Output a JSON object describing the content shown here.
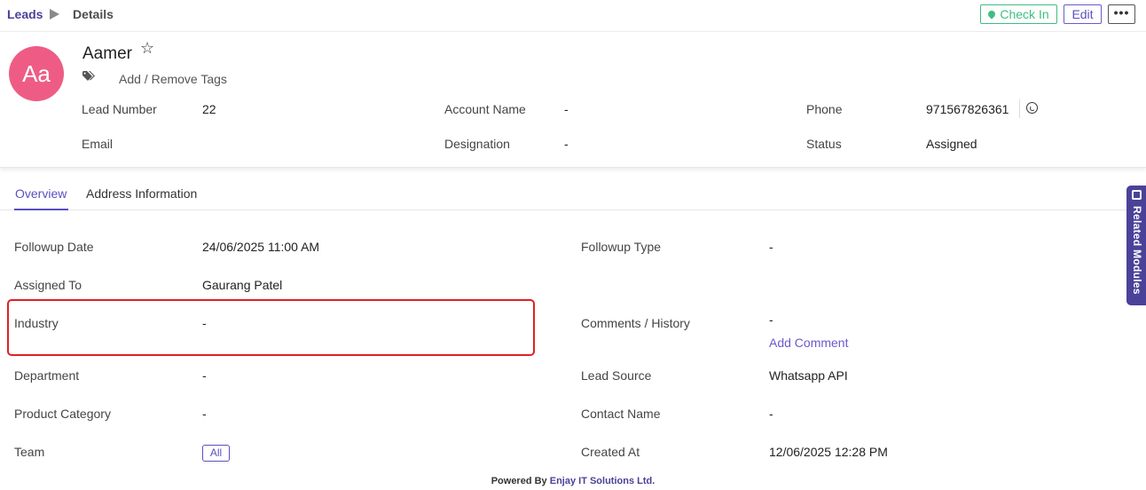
{
  "breadcrumb": {
    "root": "Leads",
    "current": "Details"
  },
  "toolbar": {
    "checkin_label": "Check In",
    "edit_label": "Edit",
    "more_label": "•••"
  },
  "lead": {
    "avatar_initials": "Aa",
    "name": "Aamer",
    "star_icon": "☆",
    "tags_link": "Add / Remove Tags"
  },
  "header_fields": {
    "lead_number": {
      "label": "Lead Number",
      "value": "22"
    },
    "account_name": {
      "label": "Account Name",
      "value": "-"
    },
    "phone": {
      "label": "Phone",
      "value": "971567826361"
    },
    "email": {
      "label": "Email",
      "value": ""
    },
    "designation": {
      "label": "Designation",
      "value": "-"
    },
    "status": {
      "label": "Status",
      "value": "Assigned"
    }
  },
  "tabs": [
    {
      "label": "Overview",
      "active": true
    },
    {
      "label": "Address Information",
      "active": false
    }
  ],
  "overview": {
    "followup_date": {
      "label": "Followup Date",
      "value": "24/06/2025 11:00 AM"
    },
    "followup_type": {
      "label": "Followup Type",
      "value": "-"
    },
    "assigned_to": {
      "label": "Assigned To",
      "value": "Gaurang Patel"
    },
    "industry": {
      "label": "Industry",
      "value": "-"
    },
    "comments": {
      "label": "Comments / History",
      "value": "-",
      "action": "Add Comment"
    },
    "department": {
      "label": "Department",
      "value": "-"
    },
    "lead_source": {
      "label": "Lead Source",
      "value": "Whatsapp API"
    },
    "product_category": {
      "label": "Product Category",
      "value": "-"
    },
    "contact_name": {
      "label": "Contact Name",
      "value": "-"
    },
    "team": {
      "label": "Team",
      "value": "All"
    },
    "created_at": {
      "label": "Created At",
      "value": "12/06/2025 12:28 PM"
    }
  },
  "related_modules": {
    "label": "Related Modules"
  },
  "footer": {
    "prefix": "Powered By",
    "company": "Enjay IT Solutions Ltd."
  },
  "colors": {
    "brand": "#4a4298",
    "checkin": "#3fbf7f",
    "avatar": "#ee5c86",
    "highlight": "#e02020"
  }
}
